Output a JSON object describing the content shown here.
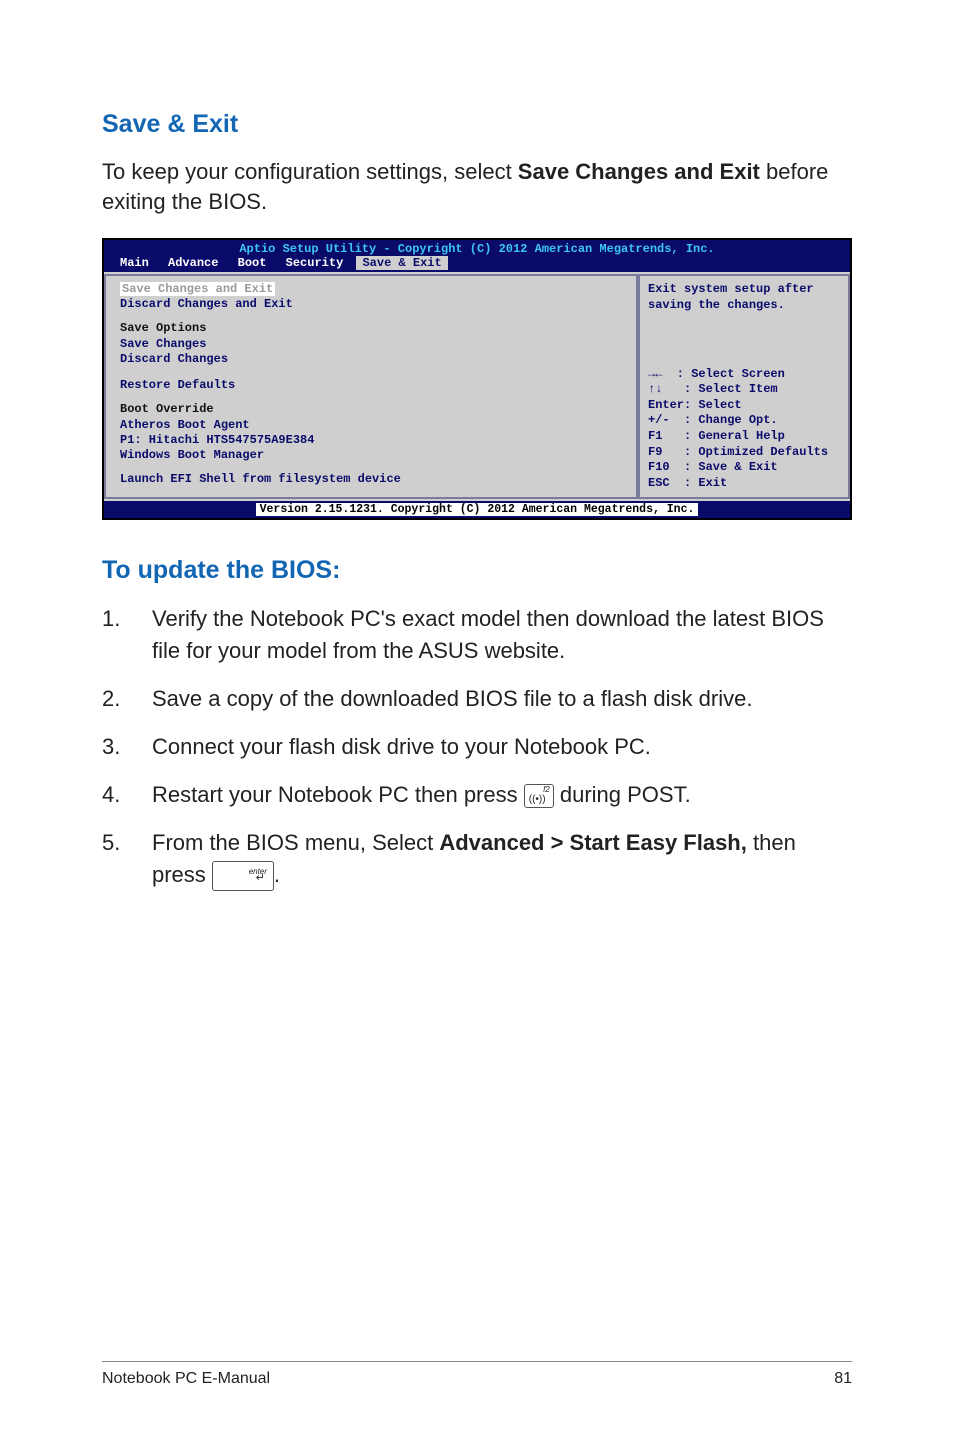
{
  "headings": {
    "save_exit": "Save & Exit",
    "update_bios": "To update the BIOS:"
  },
  "intro": {
    "pre": "To keep your configuration settings, select ",
    "bold": "Save Changes and Exit",
    "post": " before exiting the BIOS."
  },
  "bios": {
    "title": "Aptio Setup Utility - Copyright (C) 2012 American Megatrends, Inc.",
    "tabs": {
      "main": "Main",
      "advance": "Advance",
      "boot": "Boot",
      "security": "Security",
      "save_exit": "Save & Exit"
    },
    "left": {
      "selected": "Save Changes and Exit",
      "discard_exit": "Discard Changes and Exit",
      "save_options_head": "Save Options",
      "save_changes": "Save Changes",
      "discard_changes": "Discard Changes",
      "restore_defaults": "Restore Defaults",
      "boot_override_head": "Boot Override",
      "atheros": "Atheros Boot Agent",
      "p1": "P1: Hitachi HTS547575A9E384",
      "wbm": "Windows Boot Manager",
      "efi": "Launch EFI Shell from filesystem device"
    },
    "right": {
      "help_top": "Exit system setup after saving the changes.",
      "keys": "→←  : Select Screen\n↑↓   : Select Item\nEnter: Select\n+/-  : Change Opt.\nF1   : General Help\nF9   : Optimized Defaults\nF10  : Save & Exit\nESC  : Exit"
    },
    "footer": "Version 2.15.1231. Copyright (C) 2012 American Megatrends, Inc."
  },
  "steps": {
    "s1": "Verify the Notebook PC's exact model then download the latest BIOS file for your model from the ASUS website.",
    "s2": "Save a copy of the downloaded BIOS file to a flash disk drive.",
    "s3": "Connect your flash disk drive to your Notebook PC.",
    "s4_pre": "Restart your Notebook PC then press ",
    "s4_post": " during POST.",
    "s5_pre": "From the BIOS menu, Select ",
    "s5_bold": "Advanced > Start Easy Flash,",
    "s5_mid": " then press ",
    "s5_post": "."
  },
  "nums": {
    "n1": "1.",
    "n2": "2.",
    "n3": "3.",
    "n4": "4.",
    "n5": "5."
  },
  "key_labels": {
    "f2": "f2",
    "enter": "enter"
  },
  "footer": {
    "left": "Notebook PC E-Manual",
    "right": "81"
  },
  "chart_data": null
}
